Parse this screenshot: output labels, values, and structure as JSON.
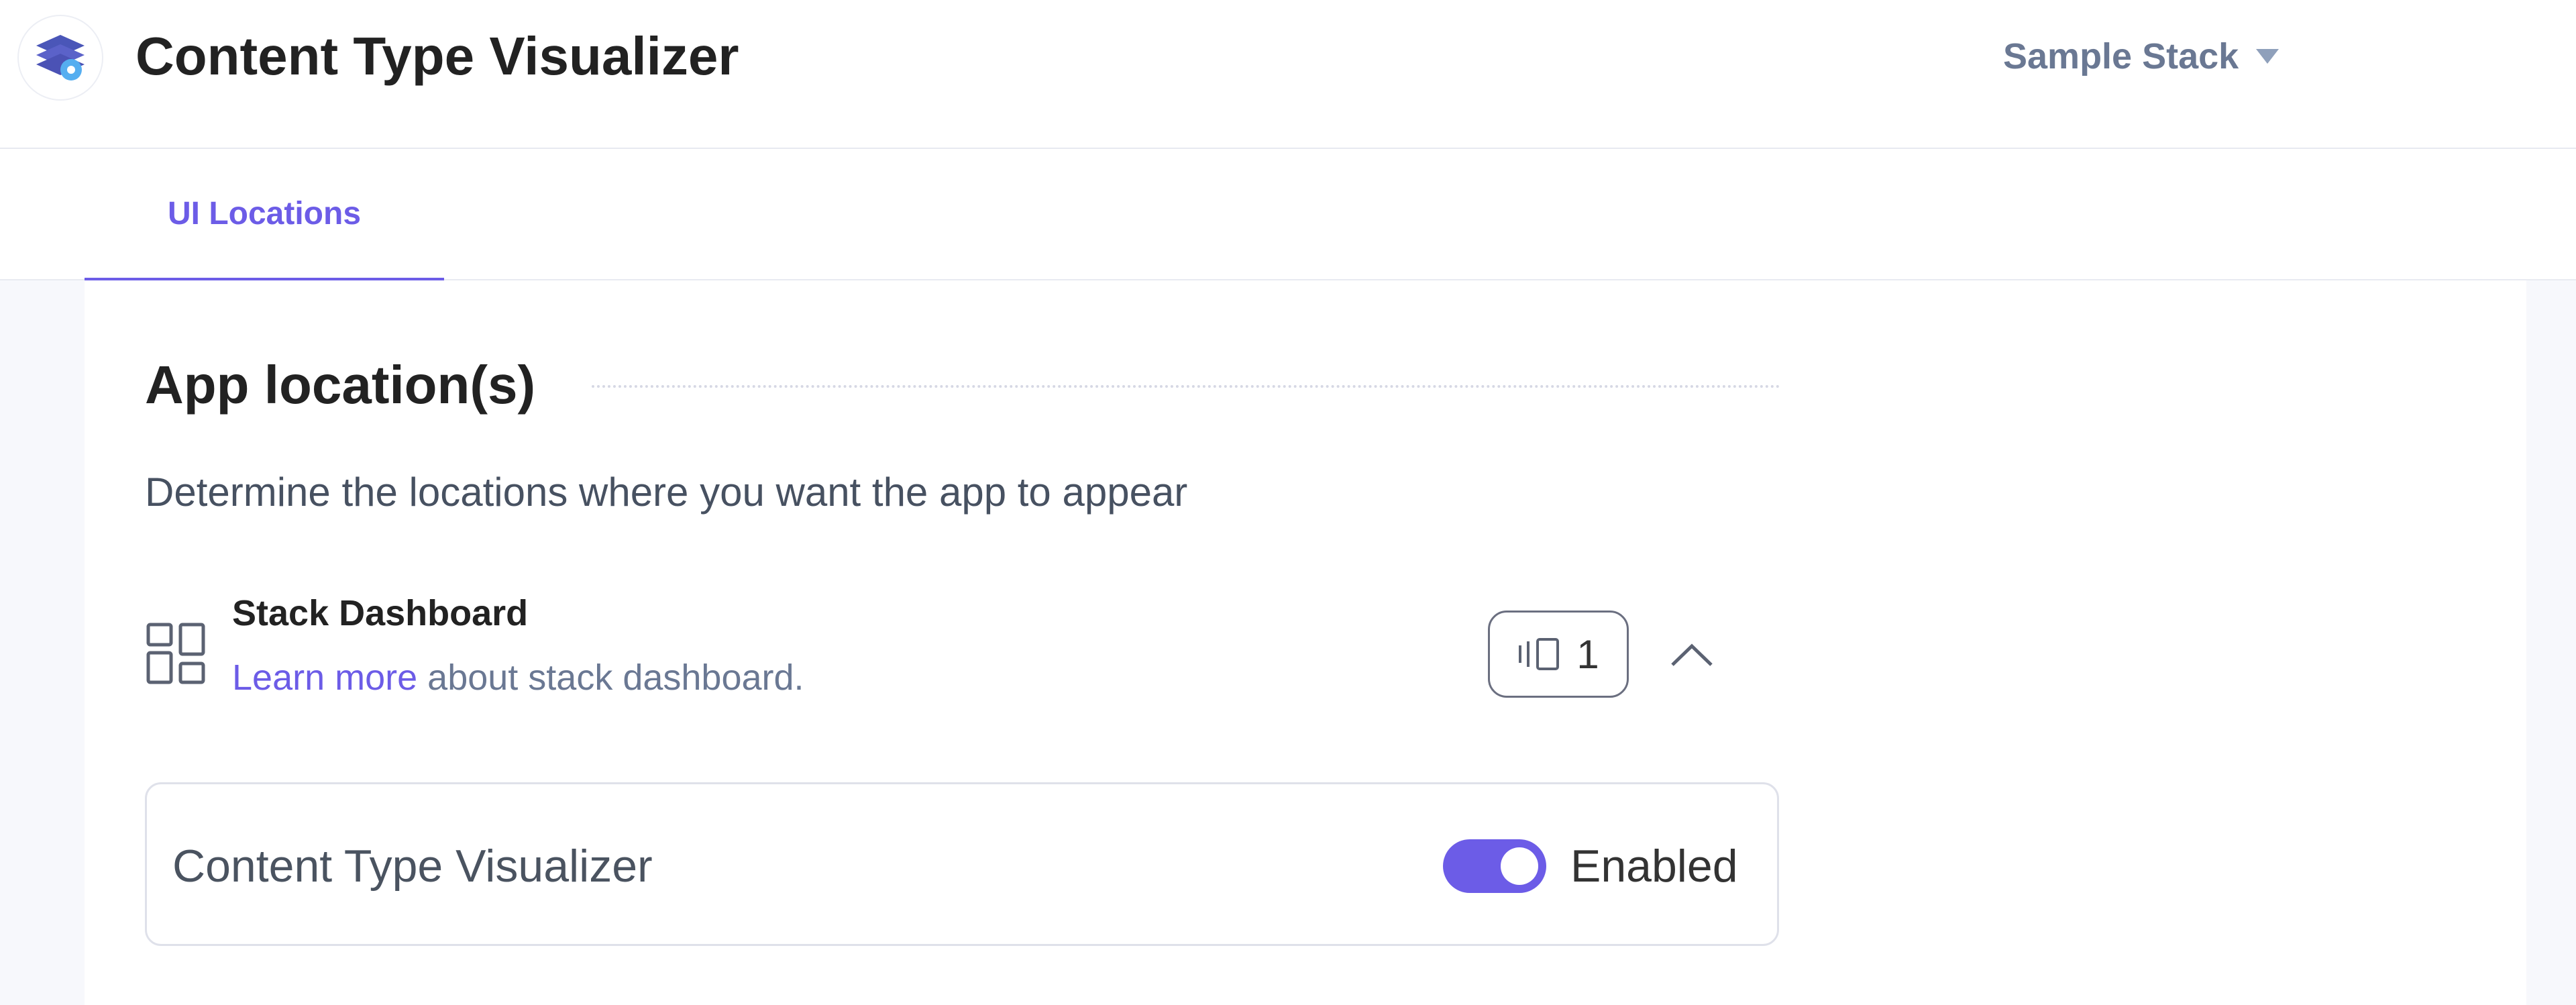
{
  "header": {
    "app_title": "Content Type Visualizer",
    "logo_icon": "stack-logo-icon",
    "stack_selector": {
      "label": "Sample Stack",
      "icon": "caret-down-icon"
    }
  },
  "tabs": [
    {
      "label": "UI Locations",
      "active": true
    }
  ],
  "section": {
    "title": "App location(s)",
    "description": "Determine the locations where you want the app to appear"
  },
  "location": {
    "icon": "dashboard-layout-icon",
    "name": "Stack Dashboard",
    "learn_more_link": "Learn more",
    "help_suffix": " about stack dashboard.",
    "count": "1",
    "count_icon": "widget-icon",
    "collapse_icon": "chevron-up-icon",
    "entry": {
      "name": "Content Type Visualizer",
      "toggle_state": "on",
      "toggle_label": "Enabled"
    }
  },
  "colors": {
    "accent": "#6c5ce7",
    "title_text": "#222222",
    "muted_text": "#6a7893",
    "page_background": "#f7f8fc"
  }
}
